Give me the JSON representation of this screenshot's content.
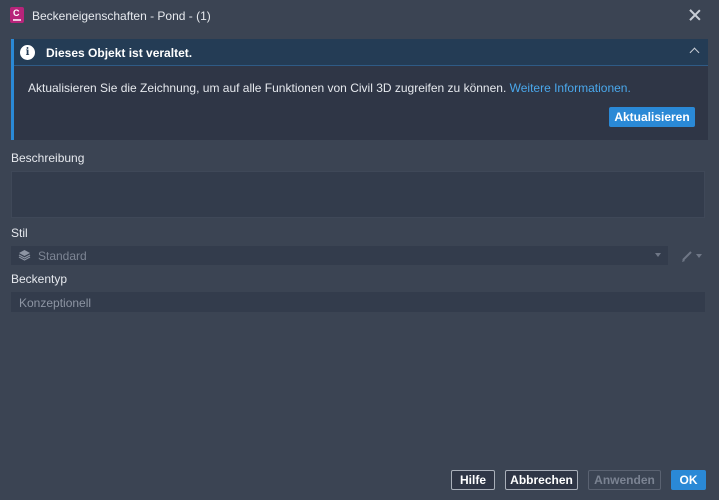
{
  "window": {
    "title": "Beckeneigenschaften - Pond - (1)",
    "app_icon": "civil3d-app-icon",
    "close_icon": "close-icon"
  },
  "banner": {
    "title": "Dieses Objekt ist veraltet.",
    "message": "Aktualisieren Sie die Zeichnung, um auf alle Funktionen von Civil 3D zugreifen zu können.",
    "link": "Weitere Informationen.",
    "update_button": "Aktualisieren",
    "accent_color": "#2a89d6"
  },
  "fields": {
    "description_label": "Beschreibung",
    "description_value": "",
    "style_label": "Stil",
    "style_value": "Standard",
    "basin_type_label": "Beckentyp",
    "basin_type_value": "Konzeptionell"
  },
  "footer": {
    "help": "Hilfe",
    "cancel": "Abbrechen",
    "apply": "Anwenden",
    "ok": "OK"
  }
}
